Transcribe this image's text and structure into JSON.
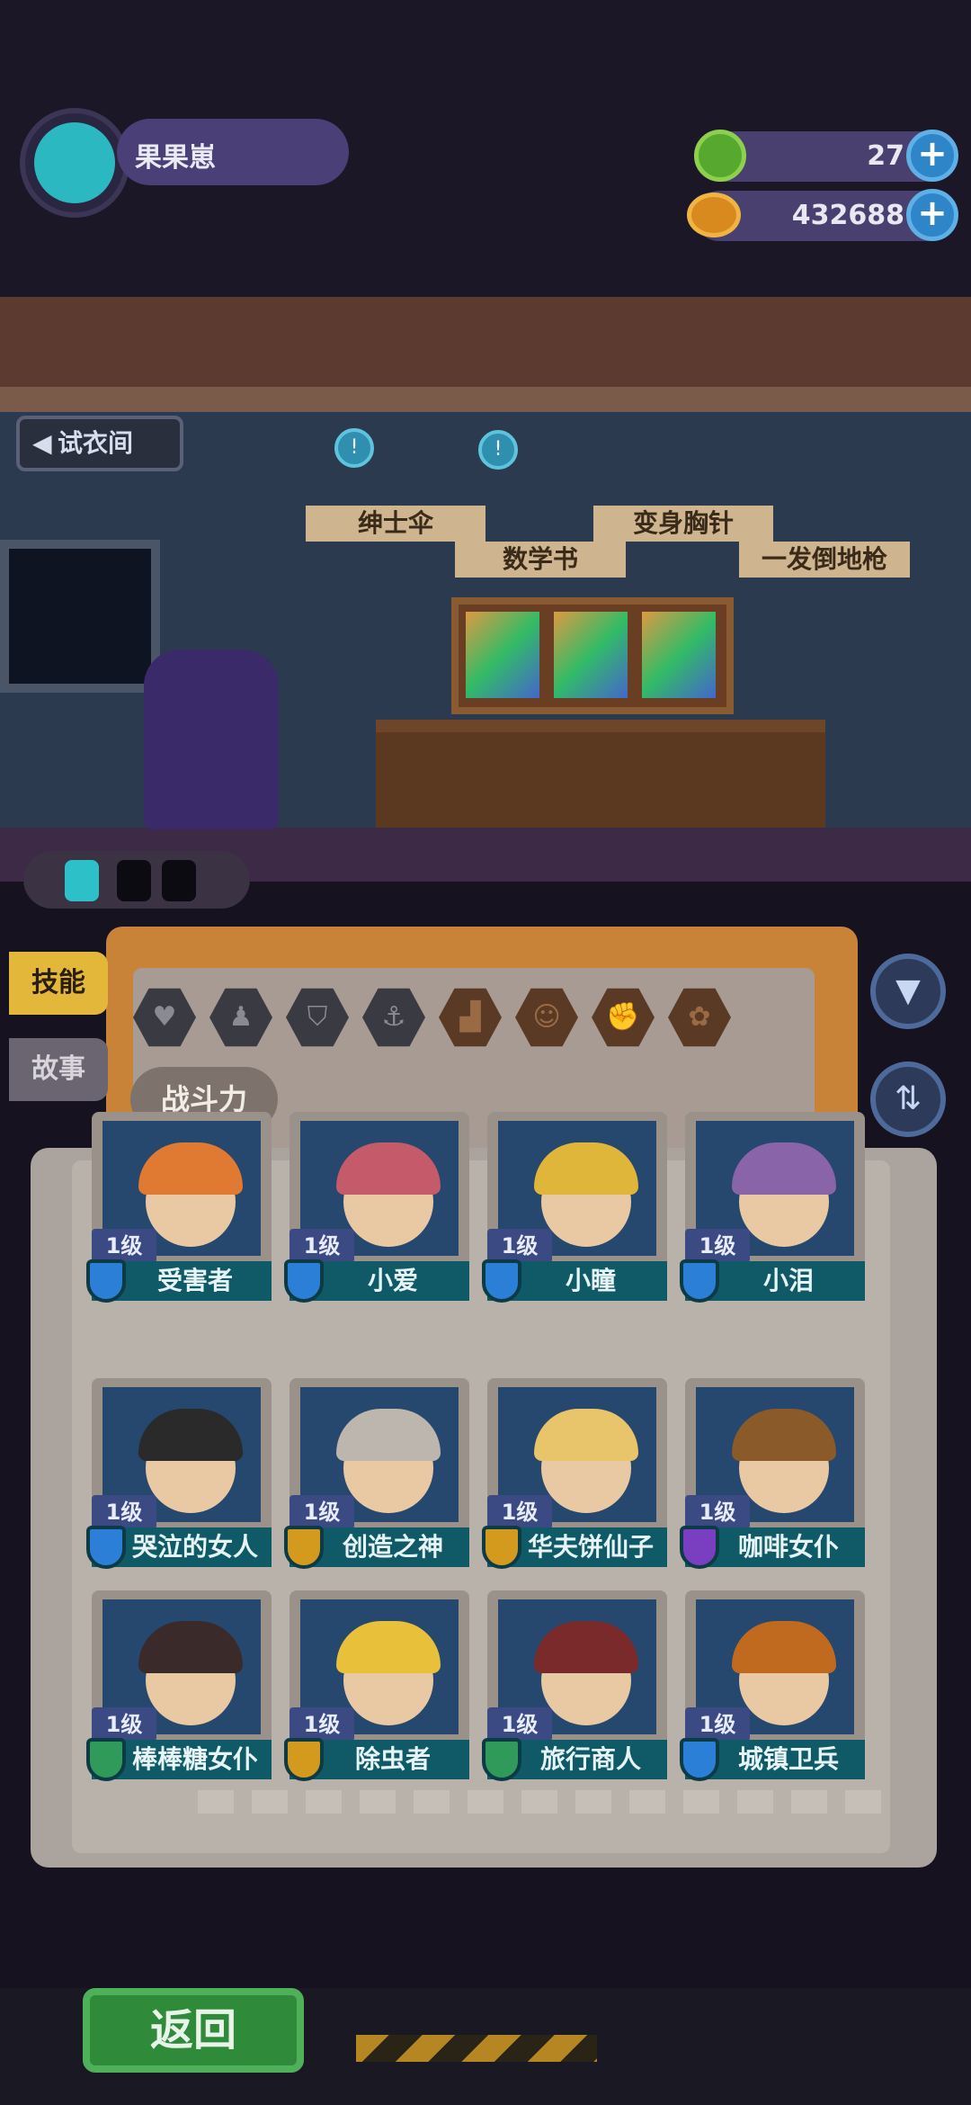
{
  "profile": {
    "name": "果果崽",
    "avatar_icon": "cat-face-icon"
  },
  "resources": [
    {
      "name": "green-gem",
      "value": "27"
    },
    {
      "name": "gold-coin",
      "value": "432688"
    }
  ],
  "room": {
    "fitting_room_label": "试衣间",
    "shelf_items": [
      "绅士伞",
      "数学书",
      "变身胸针",
      "一发倒地枪"
    ]
  },
  "panel": {
    "tabs": [
      "技能",
      "故事"
    ],
    "power_label": "战斗力",
    "hex_filters": [
      "heart-icon",
      "bell-icon",
      "shield-icon",
      "anchor-icon",
      "boot-icon",
      "smile-icon",
      "muscle-icon",
      "brain-icon"
    ]
  },
  "characters": [
    {
      "level": "1级",
      "name": "受害者",
      "shield_color": "#2b7fd6",
      "hair": "#e07a32"
    },
    {
      "level": "1级",
      "name": "小爱",
      "shield_color": "#2b7fd6",
      "hair": "#c45a6a"
    },
    {
      "level": "1级",
      "name": "小瞳",
      "shield_color": "#2b7fd6",
      "hair": "#e0b63a"
    },
    {
      "level": "1级",
      "name": "小泪",
      "shield_color": "#2b7fd6",
      "hair": "#8a64a8"
    },
    {
      "level": "1级",
      "name": "哭泣的女人",
      "shield_color": "#2b7fd6",
      "hair": "#2a2a2a"
    },
    {
      "level": "1级",
      "name": "创造之神",
      "shield_color": "#d49a1e",
      "hair": "#bdb6ae"
    },
    {
      "level": "1级",
      "name": "华夫饼仙子",
      "shield_color": "#d49a1e",
      "hair": "#e8c46a"
    },
    {
      "level": "1级",
      "name": "咖啡女仆",
      "shield_color": "#7a3ec0",
      "hair": "#8a5a2a"
    },
    {
      "level": "1级",
      "name": "棒棒糖女仆",
      "shield_color": "#2f9a5a",
      "hair": "#3a2a2a"
    },
    {
      "level": "1级",
      "name": "除虫者",
      "shield_color": "#d49a1e",
      "hair": "#e8c03a"
    },
    {
      "level": "1级",
      "name": "旅行商人",
      "shield_color": "#2f9a5a",
      "hair": "#7a2a2a"
    },
    {
      "level": "1级",
      "name": "城镇卫兵",
      "shield_color": "#2b7fd6",
      "hair": "#c06a20"
    }
  ],
  "footer": {
    "back_label": "返回"
  }
}
